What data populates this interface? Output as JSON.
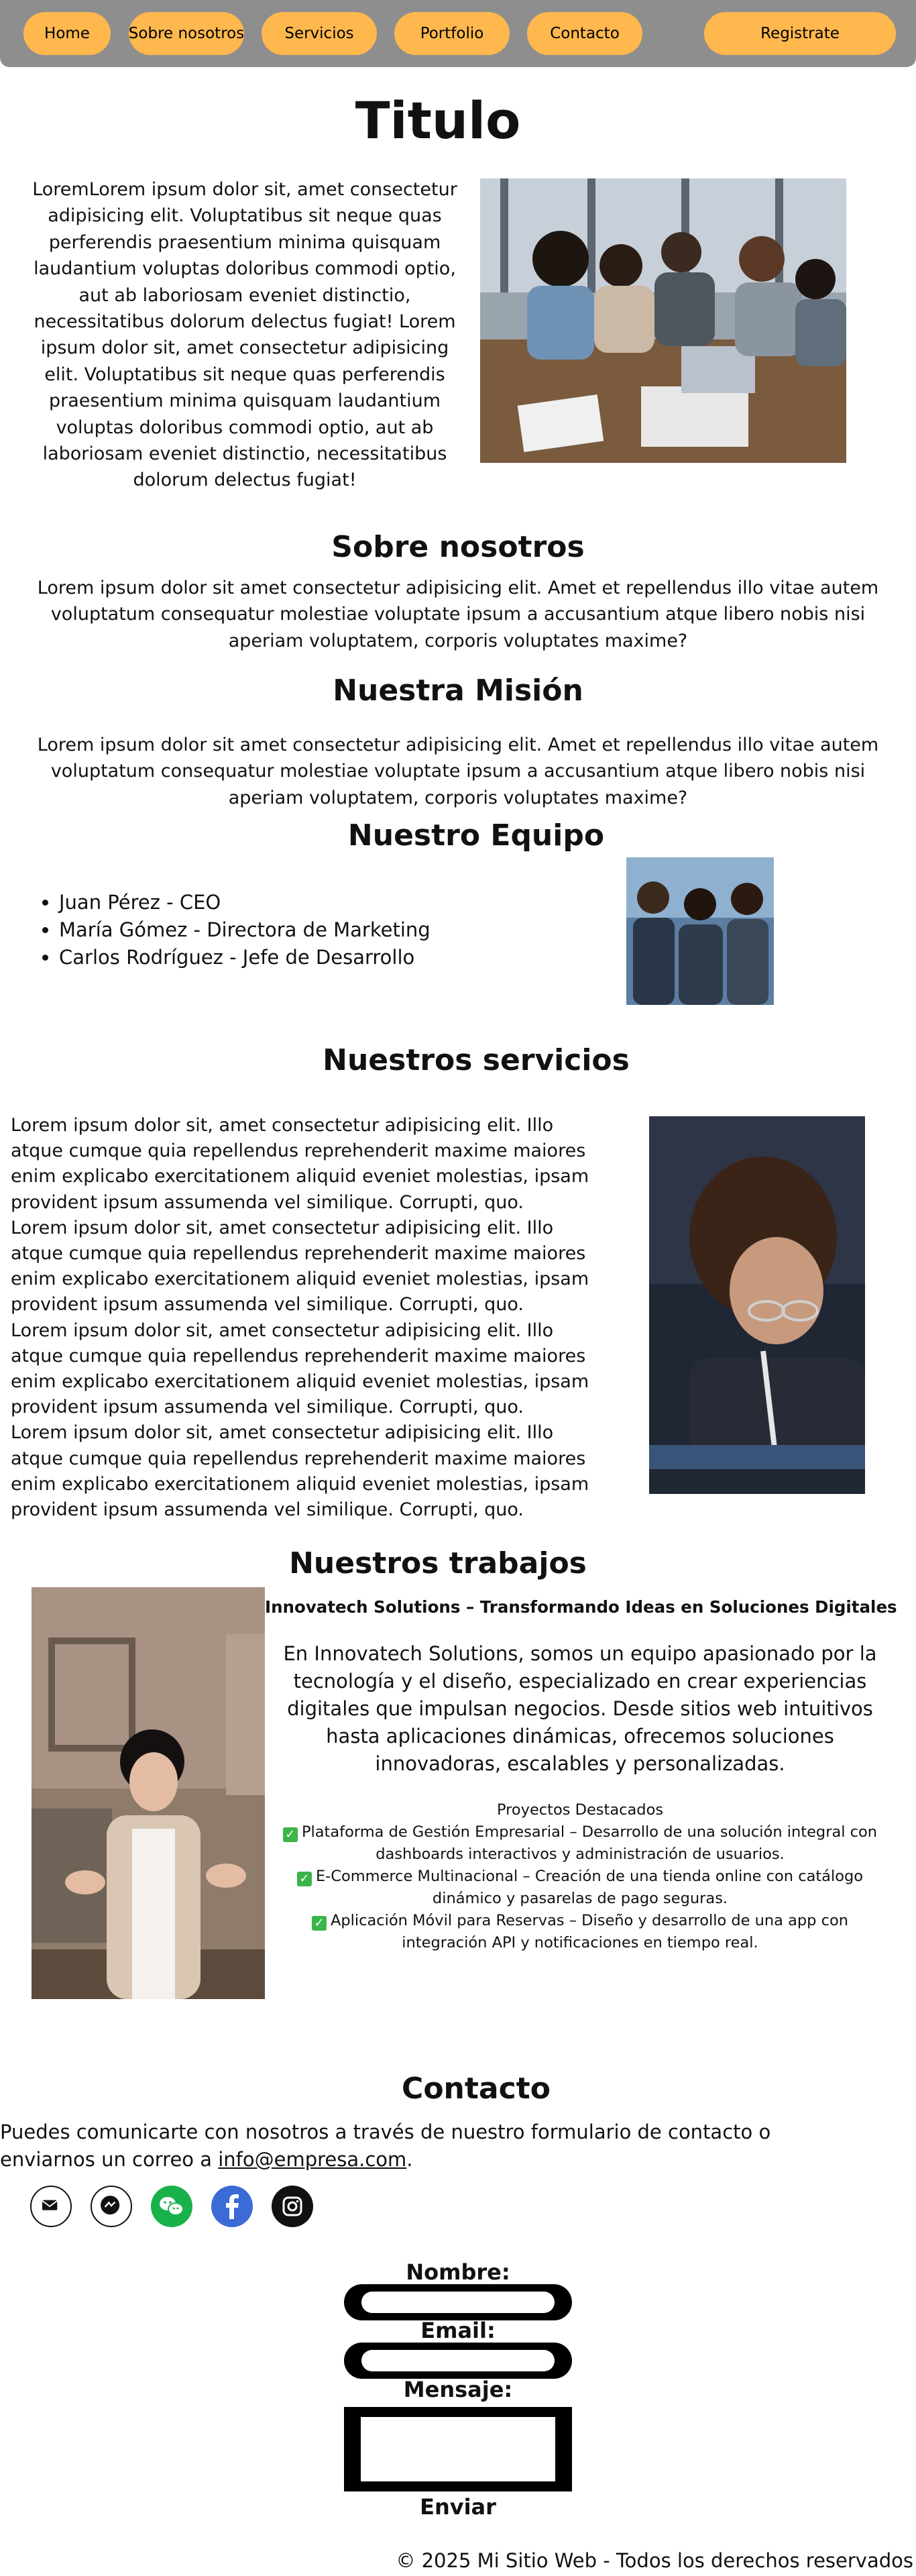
{
  "nav": {
    "items": [
      "Home",
      "Sobre nosotros",
      "Servicios",
      "Portfolio",
      "Contacto"
    ],
    "register_label": "Registrate"
  },
  "colors": {
    "nav_bg": "#8e8e8e",
    "button": "#ffb84d",
    "check_green": "#3bb54a"
  },
  "hero": {
    "title": "Titulo",
    "text": "LoremLorem ipsum dolor sit, amet consectetur adipisicing elit. Voluptatibus sit neque quas perferendis praesentium minima quisquam laudantium voluptas doloribus commodi optio, aut ab laboriosam eveniet distinctio, necessitatibus dolorum delectus fugiat! Lorem ipsum dolor sit, amet consectetur adipisicing elit. Voluptatibus sit neque quas perferendis praesentium minima quisquam laudantium voluptas doloribus commodi optio, aut ab laboriosam eveniet distinctio, necessitatibus dolorum delectus fugiat!"
  },
  "about": {
    "heading": "Sobre nosotros",
    "text": "Lorem ipsum dolor sit amet consectetur adipisicing elit. Amet et repellendus illo vitae autem voluptatum consequatur molestiae voluptate ipsum a accusantium atque libero nobis nisi aperiam voluptatem, corporis voluptates maxime?"
  },
  "mission": {
    "heading": "Nuestra Misión",
    "text": "Lorem ipsum dolor sit amet consectetur adipisicing elit. Amet et repellendus illo vitae autem voluptatum consequatur molestiae voluptate ipsum a accusantium atque libero nobis nisi aperiam voluptatem, corporis voluptates maxime?"
  },
  "team": {
    "heading": "Nuestro Equipo",
    "members": [
      "Juan Pérez - CEO",
      "María Gómez - Directora de Marketing",
      "Carlos Rodríguez - Jefe de Desarrollo"
    ]
  },
  "services": {
    "heading": "Nuestros servicios",
    "paragraphs": [
      "Lorem ipsum dolor sit, amet consectetur adipisicing elit. Illo atque cumque quia repellendus reprehenderit maxime maiores enim explicabo exercitationem aliquid eveniet molestias, ipsam provident ipsum assumenda vel similique. Corrupti, quo.",
      "Lorem ipsum dolor sit, amet consectetur adipisicing elit. Illo atque cumque quia repellendus reprehenderit maxime maiores enim explicabo exercitationem aliquid eveniet molestias, ipsam provident ipsum assumenda vel similique. Corrupti, quo.",
      "Lorem ipsum dolor sit, amet consectetur adipisicing elit. Illo atque cumque quia repellendus reprehenderit maxime maiores enim explicabo exercitationem aliquid eveniet molestias, ipsam provident ipsum assumenda vel similique. Corrupti, quo.",
      "Lorem ipsum dolor sit, amet consectetur adipisicing elit. Illo atque cumque quia repellendus reprehenderit maxime maiores enim explicabo exercitationem aliquid eveniet molestias, ipsam provident ipsum assumenda vel similique. Corrupti, quo."
    ]
  },
  "works": {
    "heading": "Nuestros trabajos",
    "subheading": "Innovatech Solutions – Transformando Ideas en Soluciones Digitales",
    "intro": "En Innovatech Solutions, somos un equipo apasionado por la tecnología y el diseño, especializado en crear experiencias digitales que impulsan negocios. Desde sitios web intuitivos hasta aplicaciones dinámicas, ofrecemos soluciones innovadoras, escalables y personalizadas.",
    "projects_title": "Proyectos Destacados",
    "projects": [
      "Plataforma de Gestión Empresarial – Desarrollo de una solución integral con dashboards interactivos y administración de usuarios.",
      "E-Commerce Multinacional – Creación de una tienda online con catálogo dinámico y pasarelas de pago seguras.",
      "Aplicación Móvil para Reservas – Diseño y desarrollo de una app con integración API y notificaciones en tiempo real."
    ],
    "check_icon": "check-mark-icon"
  },
  "contact": {
    "heading": "Contacto",
    "text_before": "Puedes comunicarte con nosotros a través de nuestro formulario de contacto o enviarnos un correo a ",
    "email": "info@empresa.com",
    "text_after": ".",
    "icons": [
      "email-icon",
      "messenger-icon",
      "wechat-icon",
      "facebook-icon",
      "instagram-icon"
    ]
  },
  "form": {
    "name_label": "Nombre:",
    "email_label": "Email:",
    "message_label": "Mensaje:",
    "submit_label": "Enviar"
  },
  "footer": {
    "text": "© 2025 Mi Sitio Web - Todos los derechos reservados"
  }
}
